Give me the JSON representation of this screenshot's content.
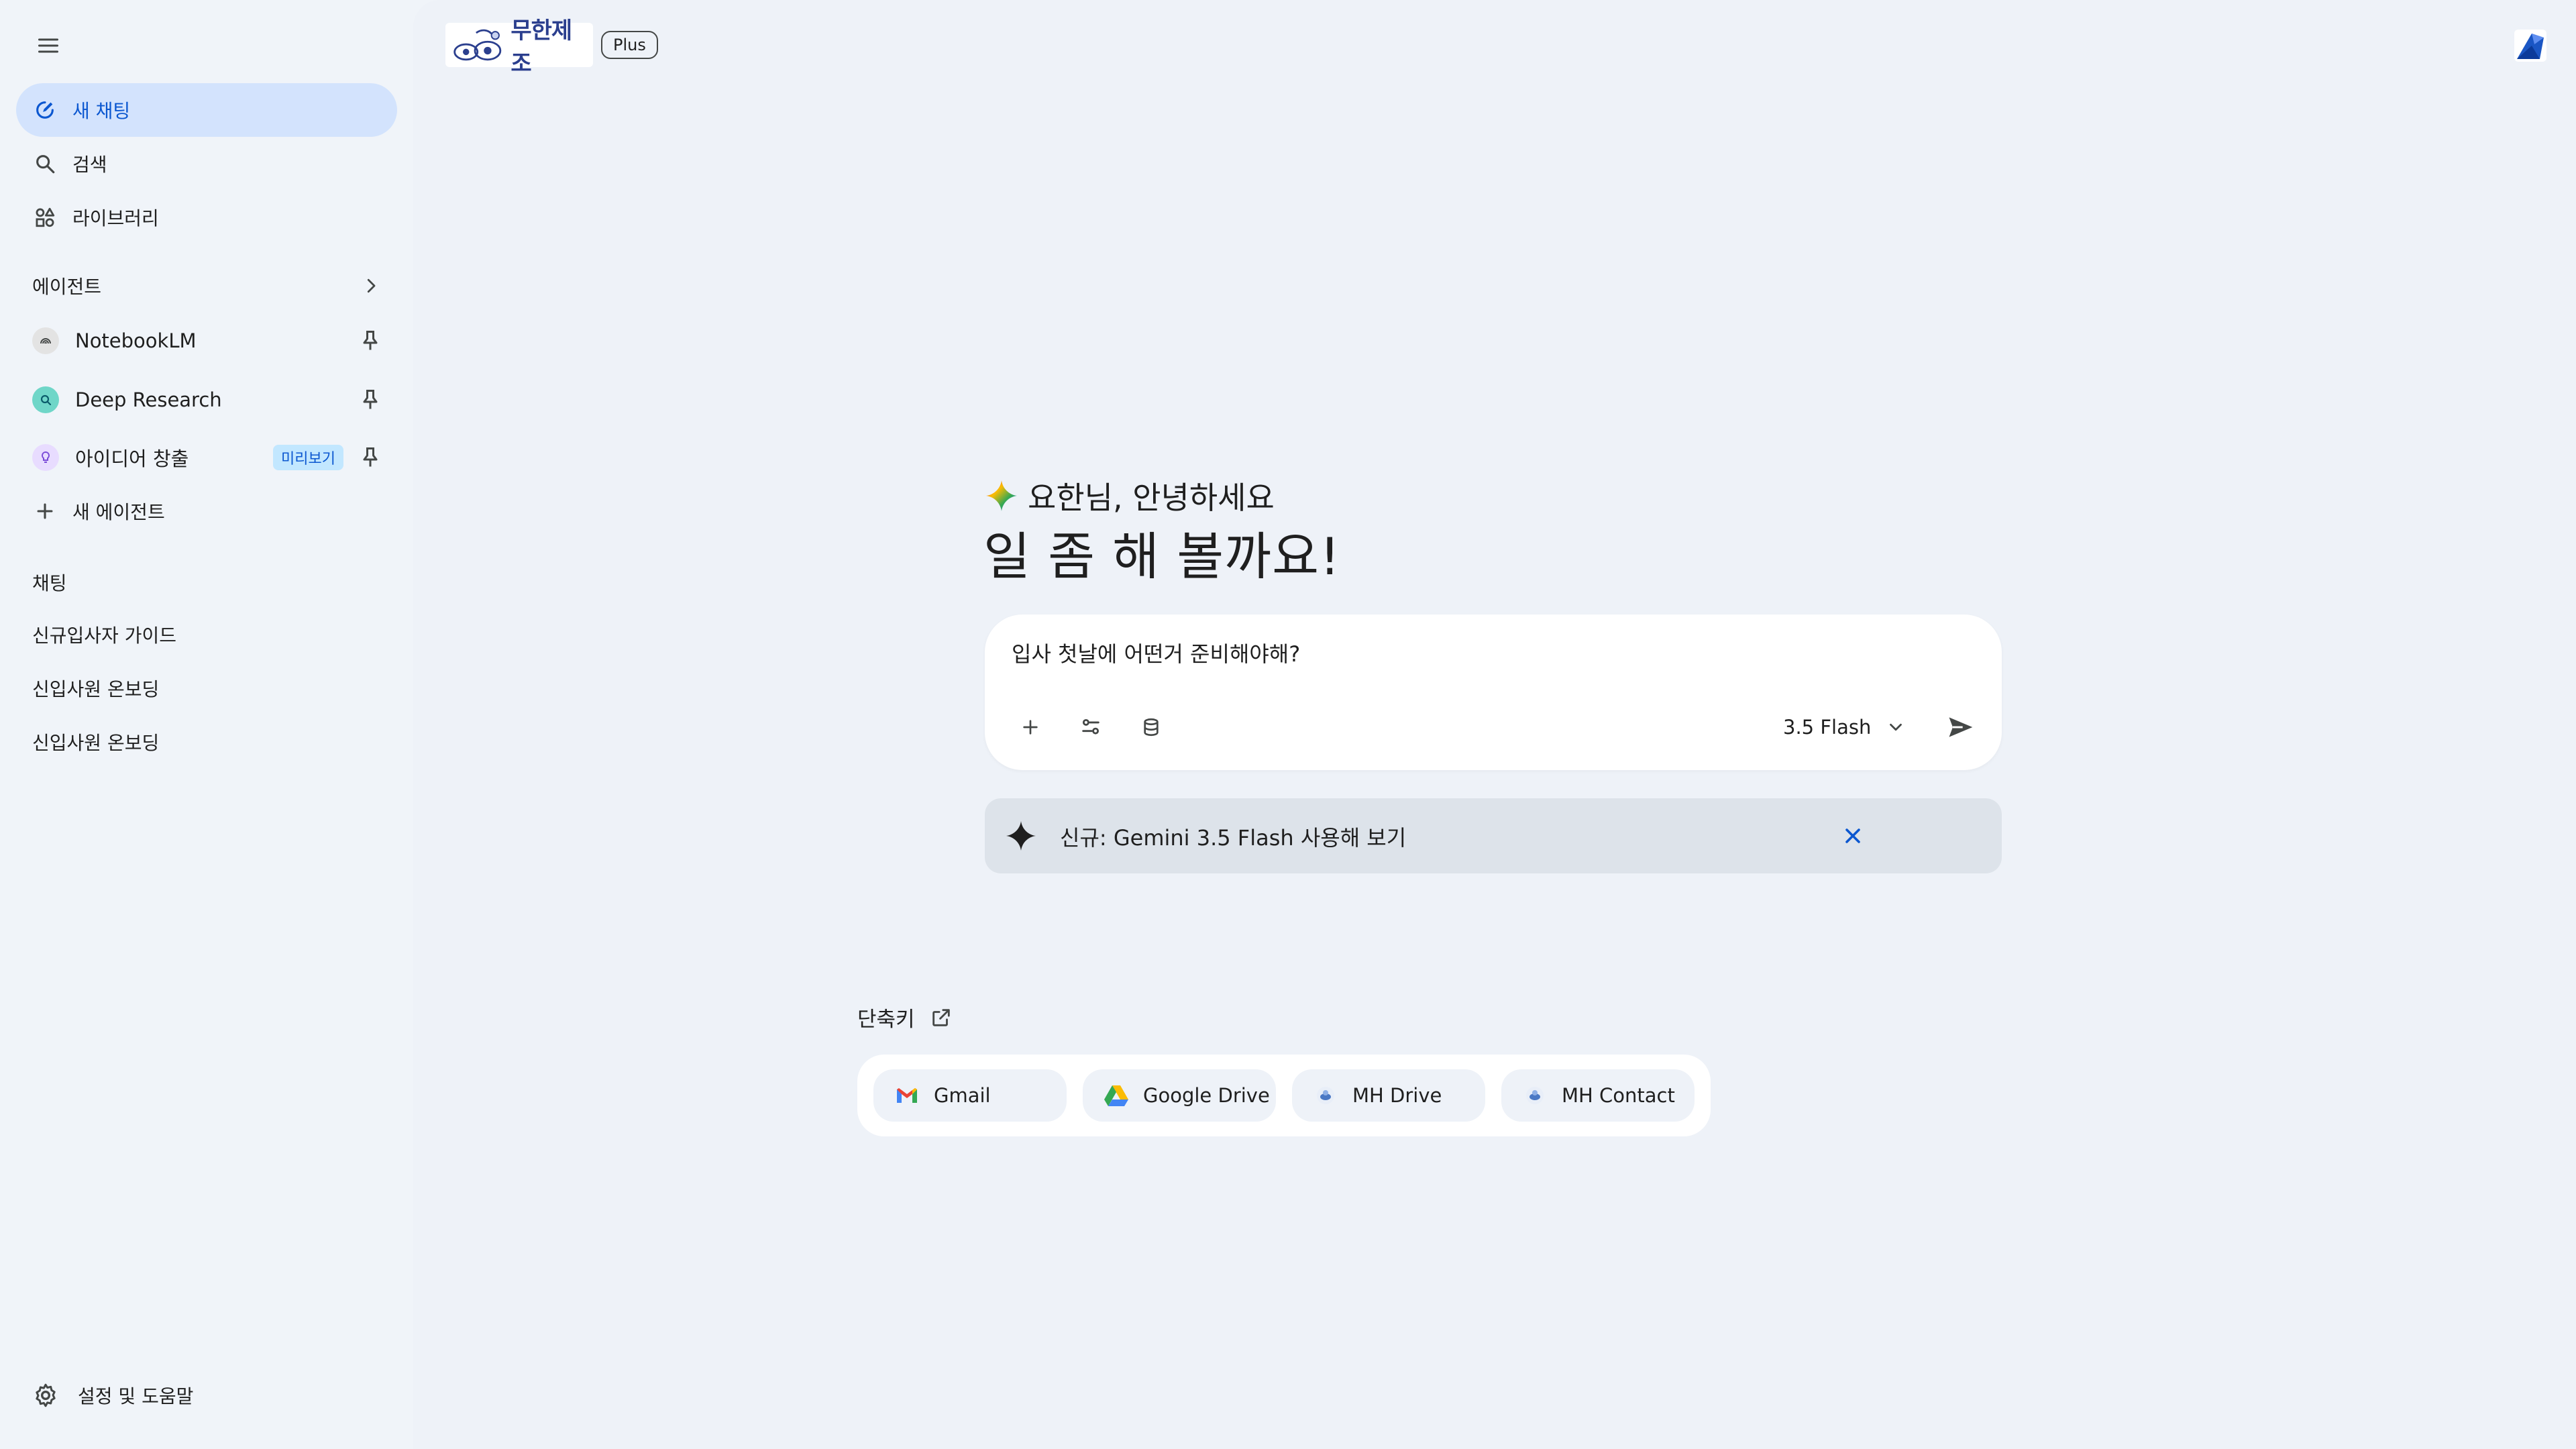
{
  "sidebar": {
    "nav": {
      "new_chat": "새 채팅",
      "search": "검색",
      "library": "라이브러리"
    },
    "agents_section": {
      "title": "에이전트",
      "items": [
        {
          "label": "NotebookLM"
        },
        {
          "label": "Deep Research"
        },
        {
          "label": "아이디어 창출",
          "badge": "미리보기"
        }
      ],
      "new_agent": "새 에이전트"
    },
    "chats_section": {
      "title": "채팅",
      "items": [
        {
          "label": "신규입사자 가이드"
        },
        {
          "label": "신입사원 온보딩"
        },
        {
          "label": "신입사원 온보딩"
        }
      ]
    },
    "settings": "설정 및 도움말"
  },
  "header": {
    "logo_text": "무한제조",
    "plan_badge": "Plus"
  },
  "main": {
    "greeting": "요한님, 안녕하세요",
    "headline": "일 좀 해 볼까요!",
    "composer": {
      "prompt_text": "입사 첫날에 어떤거 준비해야해?",
      "model": "3.5 Flash"
    },
    "banner": {
      "text": "신규: Gemini 3.5 Flash 사용해 보기"
    },
    "shortcuts": {
      "title": "단축키",
      "items": [
        {
          "label": "Gmail",
          "icon": "gmail-icon"
        },
        {
          "label": "Google Drive",
          "icon": "google-drive-icon"
        },
        {
          "label": "MH Drive",
          "icon": "mh-drive-icon"
        },
        {
          "label": "MH Contact",
          "icon": "mh-contact-icon"
        }
      ]
    }
  },
  "colors": {
    "accent": "#0b57d0",
    "active_nav_bg": "#d3e3fd",
    "background": "#f0f4f9",
    "banner_bg": "#dde3ea",
    "badge_bg": "#c2e7ff"
  }
}
